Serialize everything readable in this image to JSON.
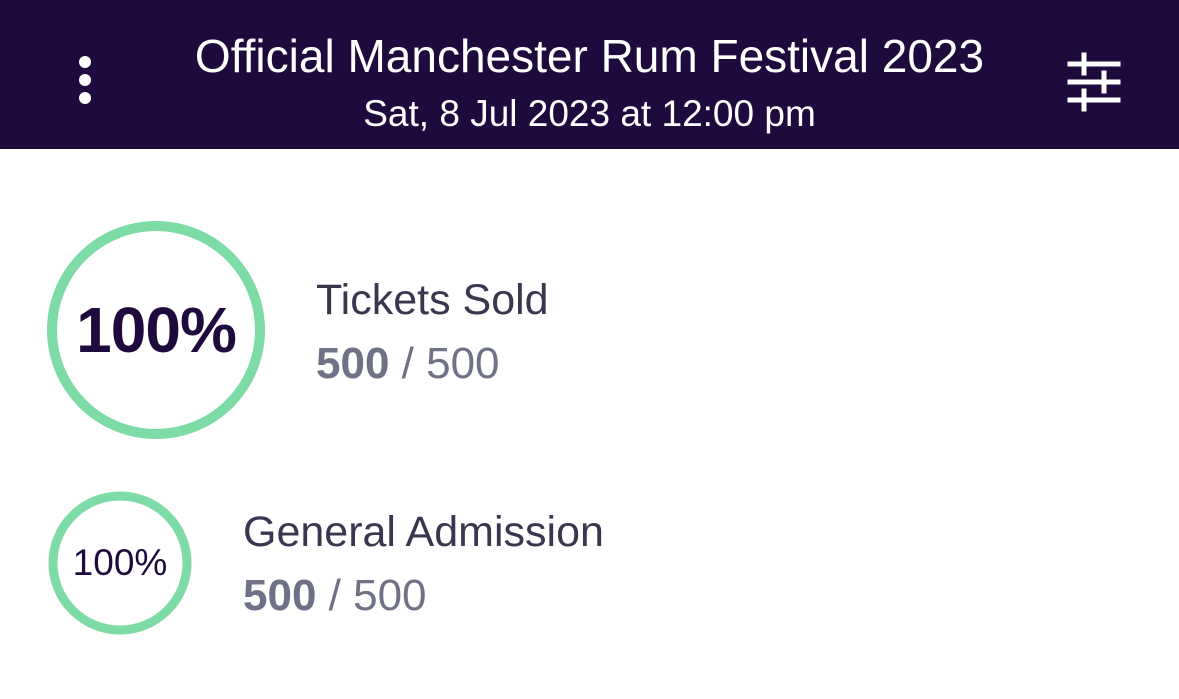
{
  "header": {
    "title": "Official Manchester Rum Festival 2023",
    "date": "Sat, 8 Jul 2023 at 12:00 pm",
    "menu_icon": "more-vertical-icon",
    "filter_icon": "sliders-icon"
  },
  "colors": {
    "header_bg": "#1e0a3c",
    "ring": "#7ddba6",
    "primary_text": "#1e0a3c",
    "secondary_text": "#6f7287"
  },
  "summary": {
    "percent": "100%",
    "label": "Tickets Sold",
    "sold": "500",
    "separator": " / ",
    "total": "500"
  },
  "ticket_types": [
    {
      "percent": "100%",
      "label": "General Admission",
      "sold": "500",
      "separator": " / ",
      "total": "500"
    }
  ]
}
